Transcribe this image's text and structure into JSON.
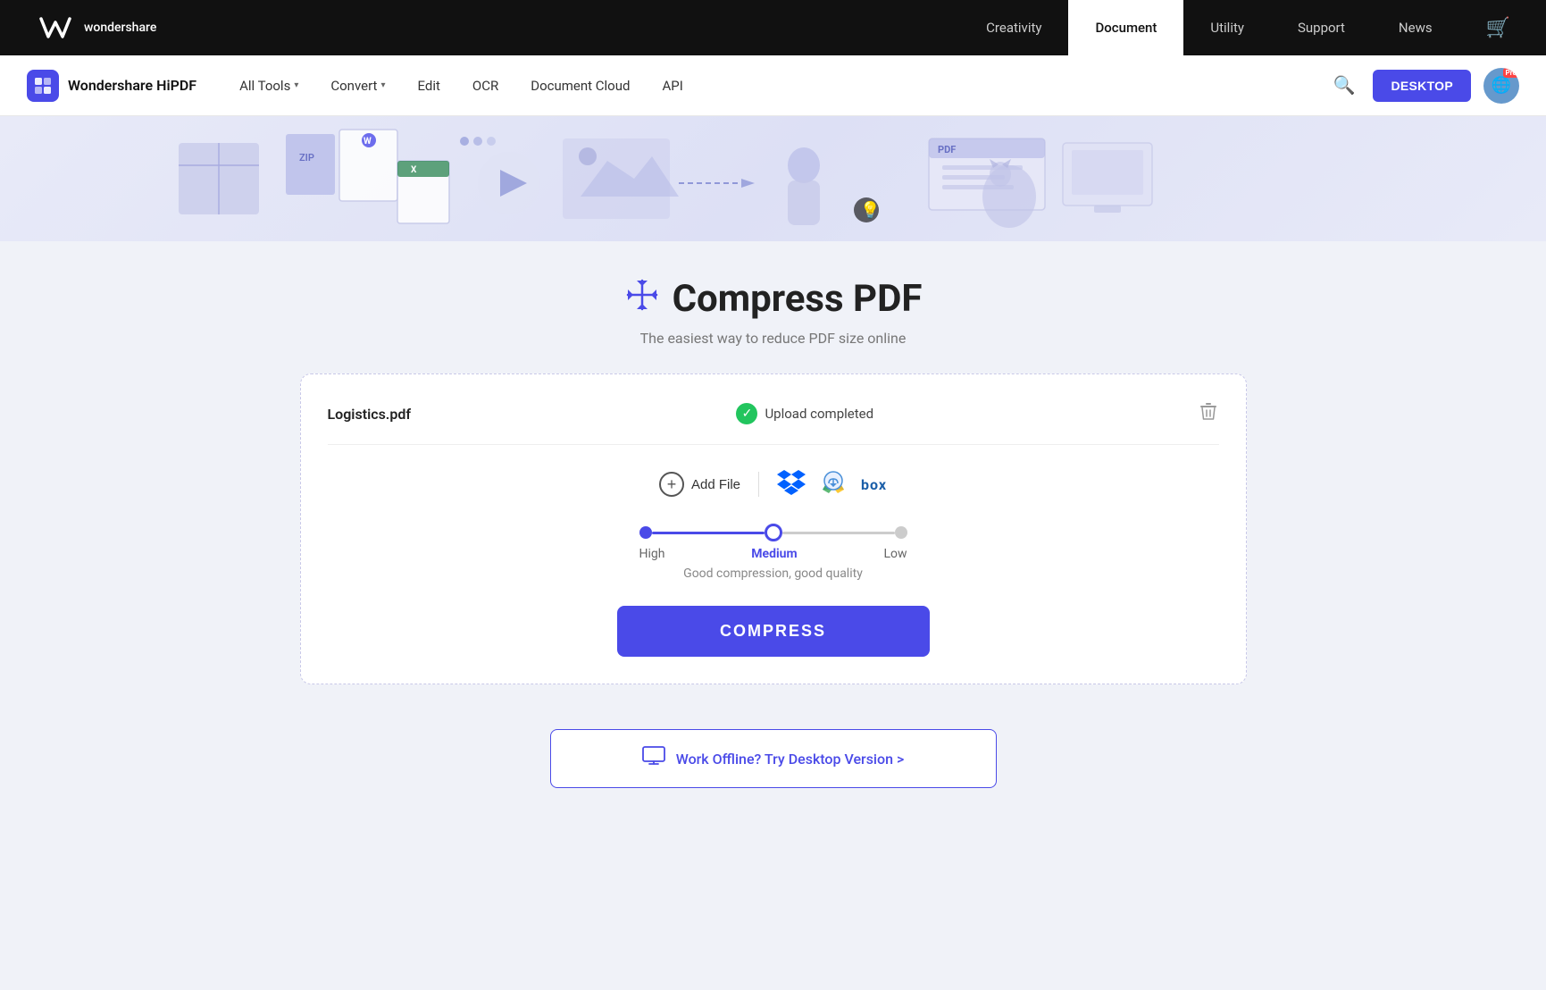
{
  "topNav": {
    "logoText": "wondershare",
    "links": [
      {
        "id": "creativity",
        "label": "Creativity",
        "active": false
      },
      {
        "id": "document",
        "label": "Document",
        "active": true
      },
      {
        "id": "utility",
        "label": "Utility",
        "active": false
      },
      {
        "id": "support",
        "label": "Support",
        "active": false
      },
      {
        "id": "news",
        "label": "News",
        "active": false
      }
    ]
  },
  "secNav": {
    "brandName": "Wondershare HiPDF",
    "items": [
      {
        "id": "all-tools",
        "label": "All Tools",
        "hasChevron": true
      },
      {
        "id": "convert",
        "label": "Convert",
        "hasChevron": true
      },
      {
        "id": "edit",
        "label": "Edit",
        "hasChevron": false
      },
      {
        "id": "ocr",
        "label": "OCR",
        "hasChevron": false
      },
      {
        "id": "document-cloud",
        "label": "Document Cloud",
        "hasChevron": false
      },
      {
        "id": "api",
        "label": "API",
        "hasChevron": false
      }
    ],
    "desktopBtn": "DESKTOP"
  },
  "page": {
    "title": "Compress PDF",
    "subtitle": "The easiest way to reduce PDF size online",
    "titleIcon": "⊕"
  },
  "fileArea": {
    "fileName": "Logistics.pdf",
    "uploadStatus": "Upload completed",
    "addFileLabel": "Add File",
    "compression": {
      "levels": [
        {
          "id": "high",
          "label": "High"
        },
        {
          "id": "medium",
          "label": "Medium"
        },
        {
          "id": "low",
          "label": "Low"
        }
      ],
      "selected": "medium",
      "description": "Good compression, good quality"
    },
    "compressBtn": "COMPRESS"
  },
  "offlineBanner": {
    "text": "Work Offline? Try Desktop Version >"
  }
}
